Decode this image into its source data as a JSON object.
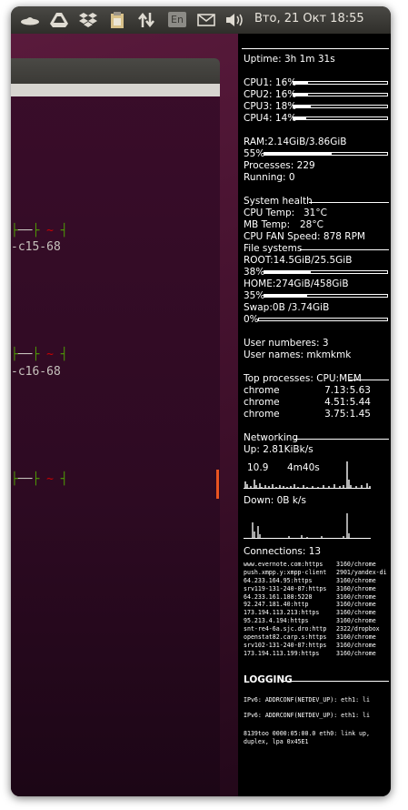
{
  "panel": {
    "keyboard_layout": "En",
    "clock": "Вто, 21 Окт 18:55",
    "icons": [
      "ufo-indicator-icon",
      "google-drive-icon",
      "dropbox-icon",
      "clipboard-icon",
      "transfer-arrows-icon",
      "mail-icon",
      "volume-icon"
    ]
  },
  "terminal": {
    "lines": [
      {
        "dash_left": "├",
        "dash_mid": "├",
        "tilde": "~",
        "dash_right": "┤",
        "label": "-c15-68"
      },
      {
        "dash_left": "├",
        "dash_mid": "├",
        "tilde": "~",
        "dash_right": "┤",
        "label": "-c16-68"
      },
      {
        "dash_left": "├",
        "dash_mid": "├",
        "tilde": "~",
        "dash_right": "┤",
        "label": ""
      }
    ]
  },
  "conky": {
    "uptime": "Uptime: 3h 1m 31s",
    "cpus": [
      {
        "label": "CPU1: 16%",
        "value": 16
      },
      {
        "label": "CPU2: 16%",
        "value": 16
      },
      {
        "label": "CPU3: 18%",
        "value": 18
      },
      {
        "label": "CPU4: 14%",
        "value": 14
      }
    ],
    "ram": {
      "label": "RAM:2.14GiB/3.86GiB",
      "percent_label": "55%",
      "value": 55
    },
    "processes": "Processes: 229",
    "running": "Running: 0",
    "health_title": "System health",
    "cpu_temp_label": "CPU Temp:",
    "cpu_temp": "31°C",
    "mb_temp_label": "MB Temp:",
    "mb_temp": "28°C",
    "fan": "CPU FAN Speed: 878 RPM",
    "fs_title": "File systems",
    "root": {
      "label": "ROOT:14.5GiB/25.5GiB",
      "percent_label": "38%",
      "value": 38
    },
    "home": {
      "label": "HOME:274GiB/458GiB",
      "percent_label": "35%",
      "value": 35
    },
    "swap": {
      "label": "Swap:0B  /3.74GiB",
      "percent_label": "0%",
      "value": 0
    },
    "user_numbers": "User numberes: 3",
    "user_names": "User names: mkmkmk",
    "top_title": "Top processes: CPU:MEM",
    "top": [
      {
        "name": "chrome",
        "cpu": "7.13:",
        "mem": "5.63"
      },
      {
        "name": "chrome",
        "cpu": "4.51:",
        "mem": "5.44"
      },
      {
        "name": "chrome",
        "cpu": "3.75:",
        "mem": "1.45"
      }
    ],
    "net_title": "Networking",
    "up": "Up: 2.81KiBk/s",
    "up_graph_left": "10.9",
    "up_graph_right": "4m40s",
    "down": "Down: 0B  k/s",
    "connections": "Connections: 13",
    "conn_list": [
      {
        "host": "www.evernote.com:https",
        "proc": "3160/chrome"
      },
      {
        "host": "push.xmpp.y:xmpp-client",
        "proc": "2901/yandex-di"
      },
      {
        "host": "64.233.164.95:https",
        "proc": "3160/chrome"
      },
      {
        "host": "srv119-131-240-87:https",
        "proc": "3160/chrome"
      },
      {
        "host": "64.233.161.188:5228",
        "proc": "3160/chrome"
      },
      {
        "host": "92.247.181.40:http",
        "proc": "3160/chrome"
      },
      {
        "host": "173.194.113.213:https",
        "proc": "3160/chrome"
      },
      {
        "host": "95.213.4.194:https",
        "proc": "3160/chrome"
      },
      {
        "host": "snt-re4-6a.sjc.dro:http",
        "proc": "2322/dropbox"
      },
      {
        "host": "openstat82.carp.s:https",
        "proc": "3160/chrome"
      },
      {
        "host": "srv102-131-240-87:https",
        "proc": "3160/chrome"
      },
      {
        "host": "173.194.113.199:https",
        "proc": "3160/chrome"
      }
    ],
    "log_title": "LOGGING",
    "log_lines": [
      "IPv6: ADDRCONF(NETDEV_UP): eth1: li",
      "IPv6: ADDRCONF(NETDEV_UP): eth1: li",
      "8139too 0000:05:00.0 eth0: link up,",
      "duplex, lpa 0x45E1"
    ]
  }
}
